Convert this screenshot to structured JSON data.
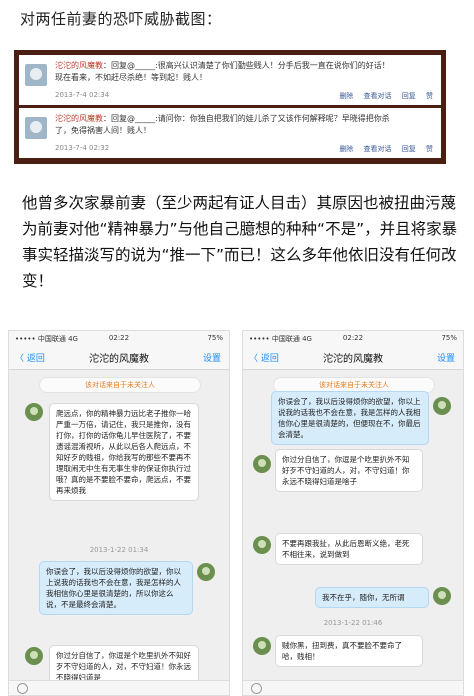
{
  "heading": "对两任前妻的恐吓威胁截图：",
  "comments": [
    {
      "name": "沱沱的风魔教",
      "line1": "回复@_____:很高兴认识清楚了你们勤些贱人！分手后我一直在说你们的好话！",
      "line2": "现在看来，不如赶尽杀绝！等到起！贱人！",
      "date": "2013-7-4 02:34",
      "actions": "删除 查看对话 回复 赞"
    },
    {
      "name": "沱沱的风魔教",
      "line1": "回复@_____:请问你：你独自把我们的娃儿杀了又该作何解释呢？早晓得把你杀",
      "line2": "了，免得祸害人间！贱人！",
      "date": "2013-7-4 02:32",
      "actions": "删除 查看对话 回复 赞"
    }
  ],
  "paragraph": "他曾多次家暴前妻（至少两起有证人目击）其原因也被扭曲污蔑为前妻对他“精神暴力”与他自己臆想的种种“不是”，并且将家暴事实轻描淡写的说为“推一下”而已！这么多年他依旧没有任何改变！",
  "phone_left": {
    "carrier": "••••• 中国联通 4G",
    "time": "02:22",
    "battery": "75%",
    "back": "〈 返回",
    "title": "沱沱的风魔教",
    "settings": "设置",
    "notice": "该对话来自于未关注人",
    "msg1": "爬远点，你的精神暴力远比老子推你一哈严重一万倍，请记住，我只是推你，没有打你，打你的话你龟儿早住医院了，不要遗谣混淆视听，从此以后各人爬远点，不知好歹的贱祖，你给我写的那些不要再不理取闹无中生有无事生非的保证你执行过哦？真的是不要脸不要命，爬远点，不要再来烦我",
    "time1": "2013-1-22 01:34",
    "msg2": "你误会了，我以后没得烦你的欲望，你以上说我的话我也不会在意，我是怎样的人我相信你心里是很清楚的，所以你这么说，不是最终会清楚。",
    "msg3": "你过分自信了，你逗是个吃里扒外不知好歹不守妇道的人，对，不守妇道！你永远不晓得妇道是"
  },
  "phone_right": {
    "carrier": "••••• 中国联通 4G",
    "time": "02:22",
    "battery": "75%",
    "back": "〈 返回",
    "title": "沱沱的风魔教",
    "settings": "设置",
    "notice": "该对话来自于未关注人",
    "msg1": "你误会了，我以后没得烦你的欲望，你以上说我的话我也不会在意，我是怎样的人我相信你心里是很清楚的，但便现在不，你最后会清楚。",
    "msg2": "你过分自信了，你逗是个吃里扒外不知好歹不守妇道的人，对，不守妇道！你永远不晓得妇道是啥子",
    "msg3": "不要再跟我扯，从此后恩断义绝，老死不相往来，说到做到",
    "msg4": "我不在乎，随你，无所谓",
    "time1": "2013-1-22 01:46",
    "msg5": "贼你黑，扭到费，真不要脸不要命了哈，贱相！"
  }
}
